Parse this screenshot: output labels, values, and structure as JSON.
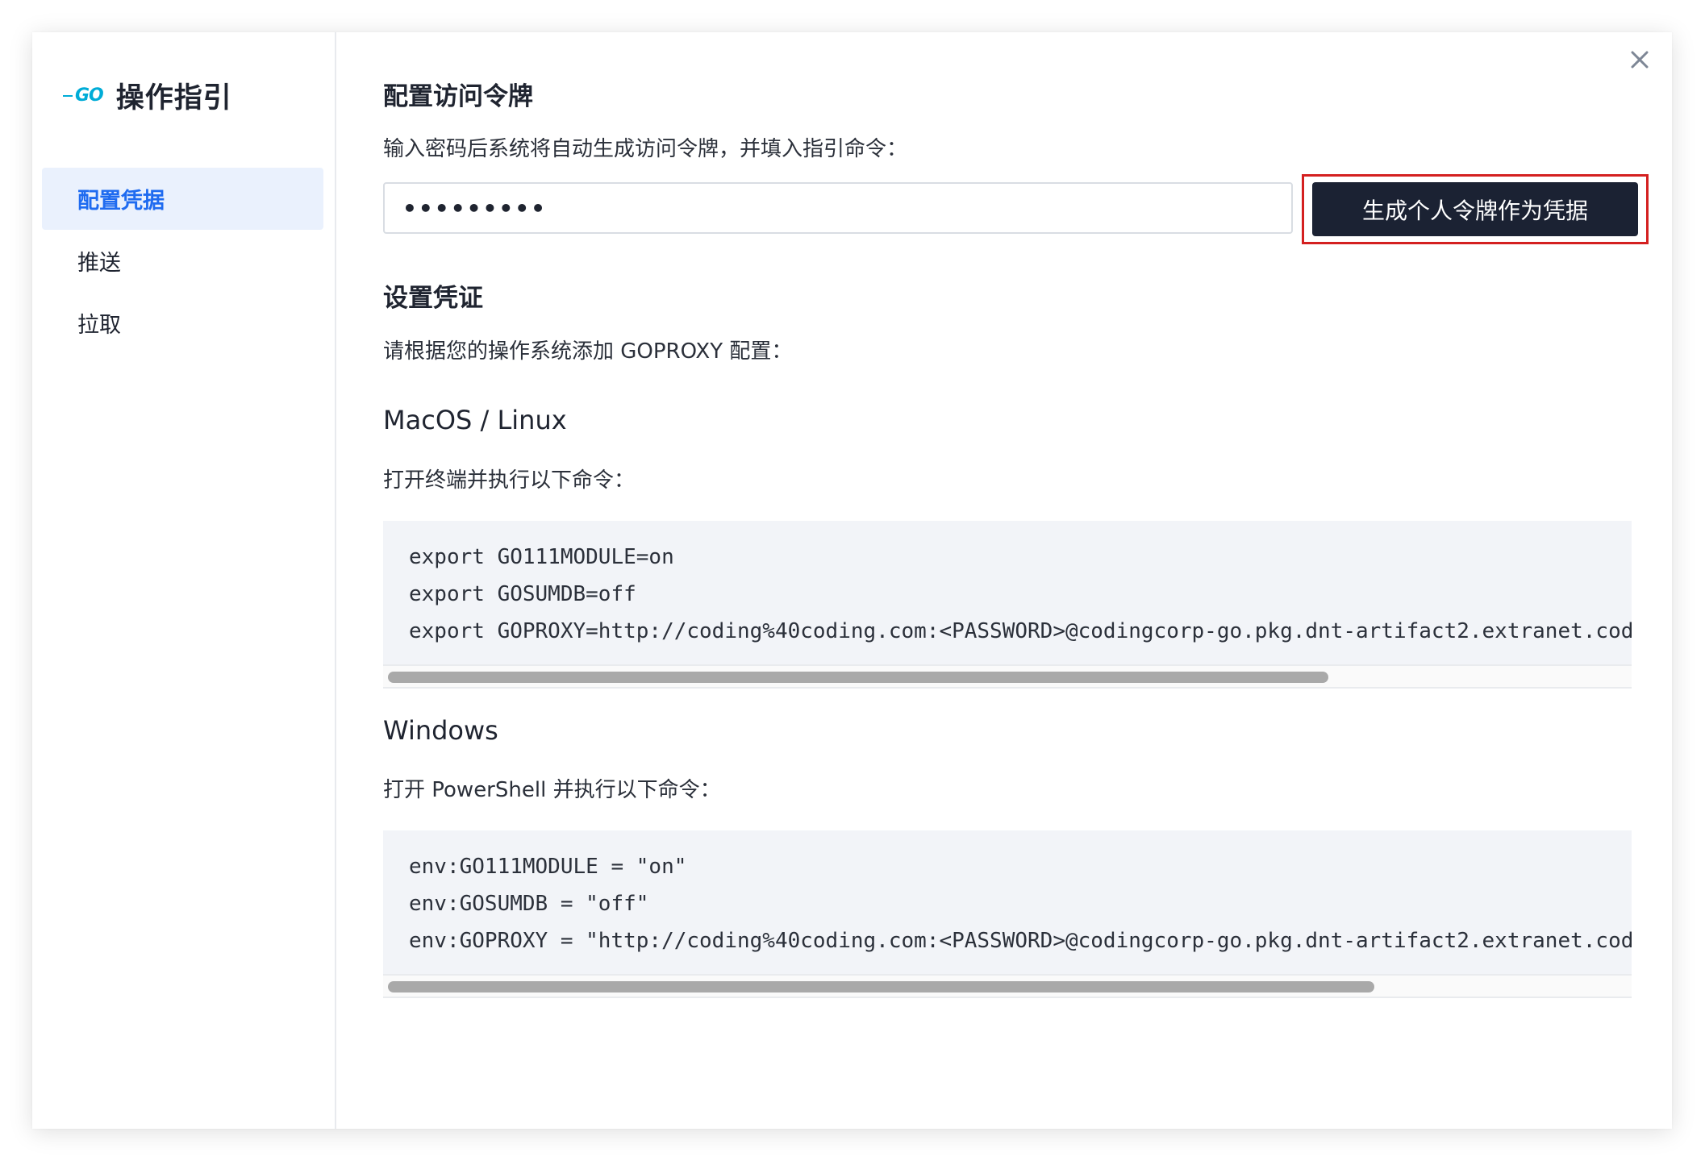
{
  "sidebar": {
    "logo_text": "GO",
    "title": "操作指引",
    "items": [
      {
        "label": "配置凭据",
        "active": true
      },
      {
        "label": "推送",
        "active": false
      },
      {
        "label": "拉取",
        "active": false
      }
    ]
  },
  "main": {
    "token_section": {
      "title": "配置访问令牌",
      "description": "输入密码后系统将自动生成访问令牌，并填入指引命令：",
      "password_value": "•••••••••",
      "generate_button": "生成个人令牌作为凭据"
    },
    "credential_section": {
      "title": "设置凭证",
      "description": "请根据您的操作系统添加 GOPROXY 配置："
    },
    "macos": {
      "title": "MacOS / Linux",
      "description": "打开终端并执行以下命令：",
      "code": [
        "export GO111MODULE=on",
        "export GOSUMDB=off",
        "export GOPROXY=http://coding%40coding.com:<PASSWORD>@codingcorp-go.pkg.dnt-artifact2.extranet.cod"
      ]
    },
    "windows": {
      "title": "Windows",
      "description": "打开 PowerShell 并执行以下命令：",
      "code": [
        "env:GO111MODULE = \"on\"",
        "env:GOSUMDB = \"off\"",
        "env:GOPROXY = \"http://coding%40coding.com:<PASSWORD>@codingcorp-go.pkg.dnt-artifact2.extranet.cod"
      ]
    }
  },
  "colors": {
    "accent": "#1f6bf0",
    "active_bg": "#eaf1fd",
    "button_bg": "#1b2233",
    "highlight_border": "#d42020",
    "code_bg": "#f2f4f8",
    "go_blue": "#00acd7"
  }
}
